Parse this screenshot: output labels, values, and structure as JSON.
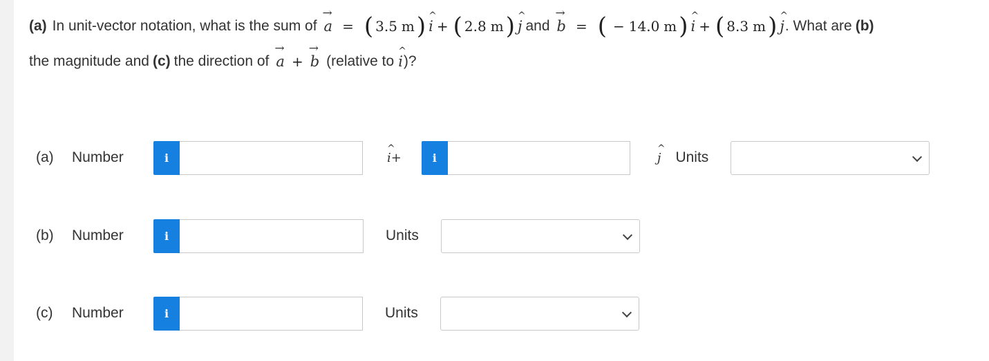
{
  "question": {
    "part_a_label": "(a)",
    "intro": "In unit-vector notation, what is the sum of",
    "vec_a": "a",
    "equals": "=",
    "a_x": "3.5",
    "a_y": "2.8",
    "unit_m": "m",
    "plus": "+",
    "unit_i": "i",
    "unit_j": "j",
    "and": "and",
    "vec_b": "b",
    "minus": "−",
    "b_x": "14.0",
    "b_y": "8.3",
    "what_are": ". What are",
    "part_b_label": "(b)",
    "magnitude_text": "the magnitude and",
    "part_c_label": "(c)",
    "direction_text": "the direction of",
    "relative_text": "(relative to",
    "relative_end": ")?"
  },
  "rows": {
    "a": {
      "letter": "(a)",
      "label": "Number",
      "info": "i",
      "mid_label": "i+",
      "end_label": "j",
      "units_label": "Units",
      "value_x": "",
      "value_y": "",
      "units_value": ""
    },
    "b": {
      "letter": "(b)",
      "label": "Number",
      "info": "i",
      "units_label": "Units",
      "value": "",
      "units_value": ""
    },
    "c": {
      "letter": "(c)",
      "label": "Number",
      "info": "i",
      "units_label": "Units",
      "value": "",
      "units_value": ""
    }
  },
  "colors": {
    "info_button": "#1680e0",
    "border": "#c8c8c8",
    "text": "#333333"
  }
}
